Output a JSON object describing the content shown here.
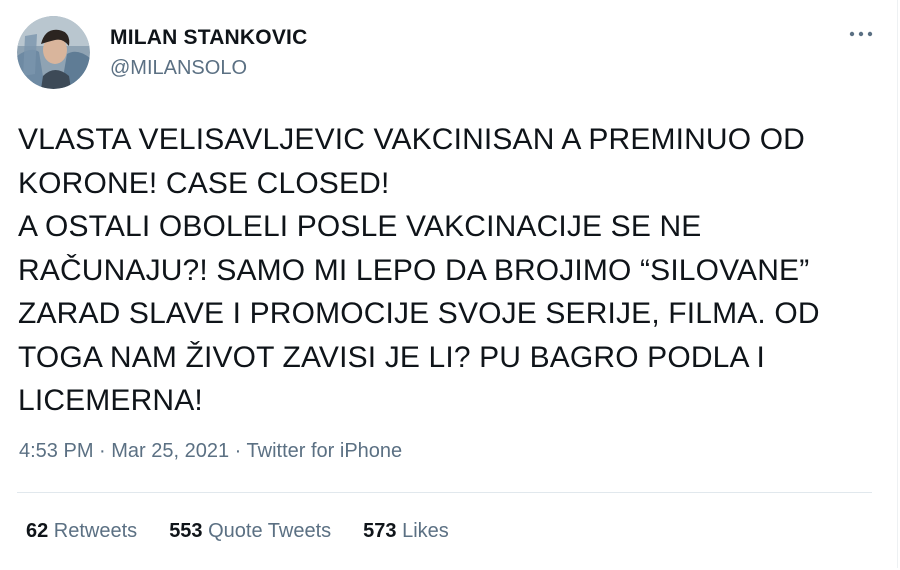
{
  "author": {
    "display_name": "MILAN STANKOVIC",
    "handle": "@MILANSOLO",
    "avatar_icon": "profile-photo"
  },
  "menu": {
    "more_icon": "more-dots-icon"
  },
  "tweet": {
    "text": "VLASTA VELISAVLJEVIC VAKCINISAN A PREMINUO OD\nKORONE! CASE CLOSED!\nA OSTALI OBOLELI POSLE VAKCINACIJE SE NE\nRAČUNAJU?! SAMO MI LEPO DA BROJIMO “SILOVANE”\nZARAD SLAVE I PROMOCIJE SVOJE SERIJE, FILMA. OD\nTOGA NAM ŽIVOT ZAVISI JE LI? PU BAGRO PODLA I\nLICEMERNA!"
  },
  "meta": {
    "time": "4:53 PM",
    "separator": " · ",
    "date": "Mar 25, 2021",
    "source": "Twitter for iPhone"
  },
  "stats": {
    "retweets_count": "62",
    "retweets_label": " Retweets",
    "quotes_count": "553",
    "quotes_label": " Quote Tweets",
    "likes_count": "573",
    "likes_label": " Likes"
  },
  "colors": {
    "primary_text": "#0f1419",
    "secondary_text": "#5b7083",
    "divider": "#e1e8ed"
  }
}
